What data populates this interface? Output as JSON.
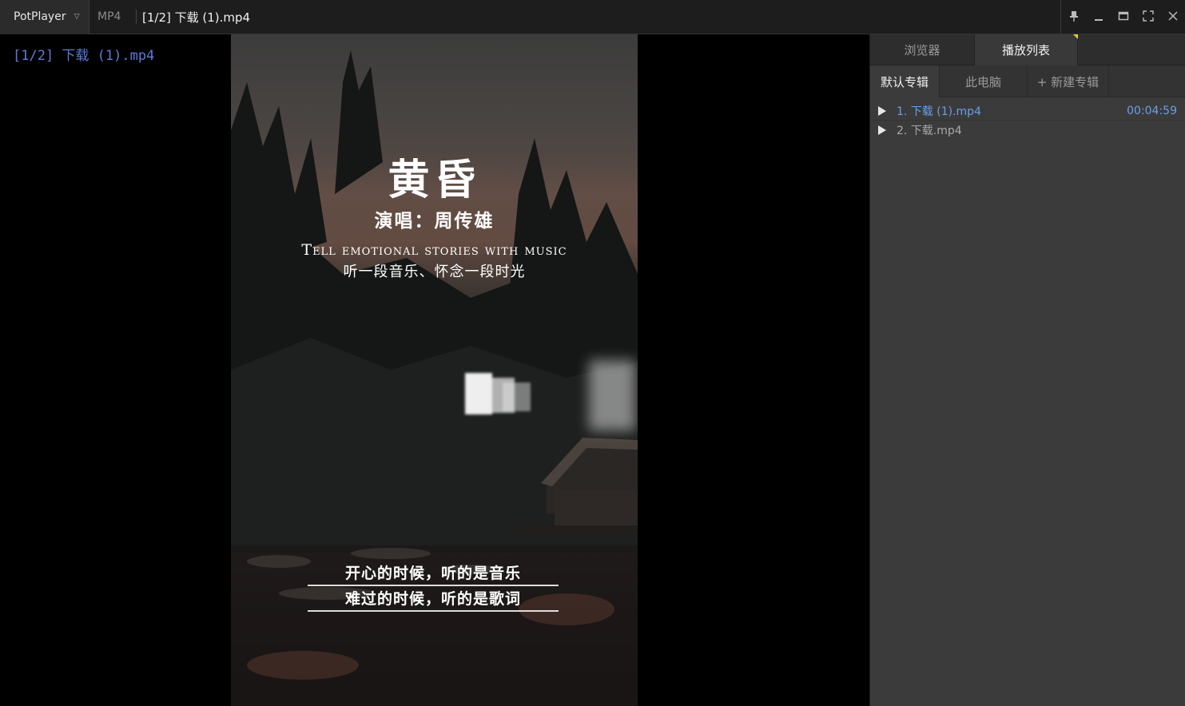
{
  "titlebar": {
    "app_name": "PotPlayer",
    "format": "MP4",
    "title": "[1/2] 下载 (1).mp4",
    "controls": [
      "pin-icon",
      "minimize-icon",
      "maximize-icon",
      "fullscreen-icon",
      "close-icon"
    ]
  },
  "video": {
    "osd_text": "[1/2] 下载 (1).mp4",
    "title": "黄昏",
    "singer": "演唱：周传雄",
    "tagline_en": "Tell emotional stories with music",
    "tagline_cn": "听一段音乐、怀念一段时光",
    "lyric1": "开心的时候，听的是音乐",
    "lyric2": "难过的时候，听的是歌词"
  },
  "panel": {
    "tabs": [
      {
        "label": "浏览器",
        "active": false
      },
      {
        "label": "播放列表",
        "active": true
      }
    ],
    "subtabs": [
      {
        "label": "默认专辑",
        "active": true
      },
      {
        "label": "此电脑",
        "active": false
      },
      {
        "label": "+ 新建专辑",
        "active": false
      }
    ],
    "playlist": [
      {
        "label": "1. 下载 (1).mp4",
        "duration": "00:04:59",
        "current": true
      },
      {
        "label": "2. 下载.mp4",
        "duration": "",
        "current": false
      }
    ]
  },
  "colors": {
    "accent_blue": "#6b9ee8",
    "osd_blue": "#5d7ad8",
    "marker_yellow": "#e6c53a"
  }
}
